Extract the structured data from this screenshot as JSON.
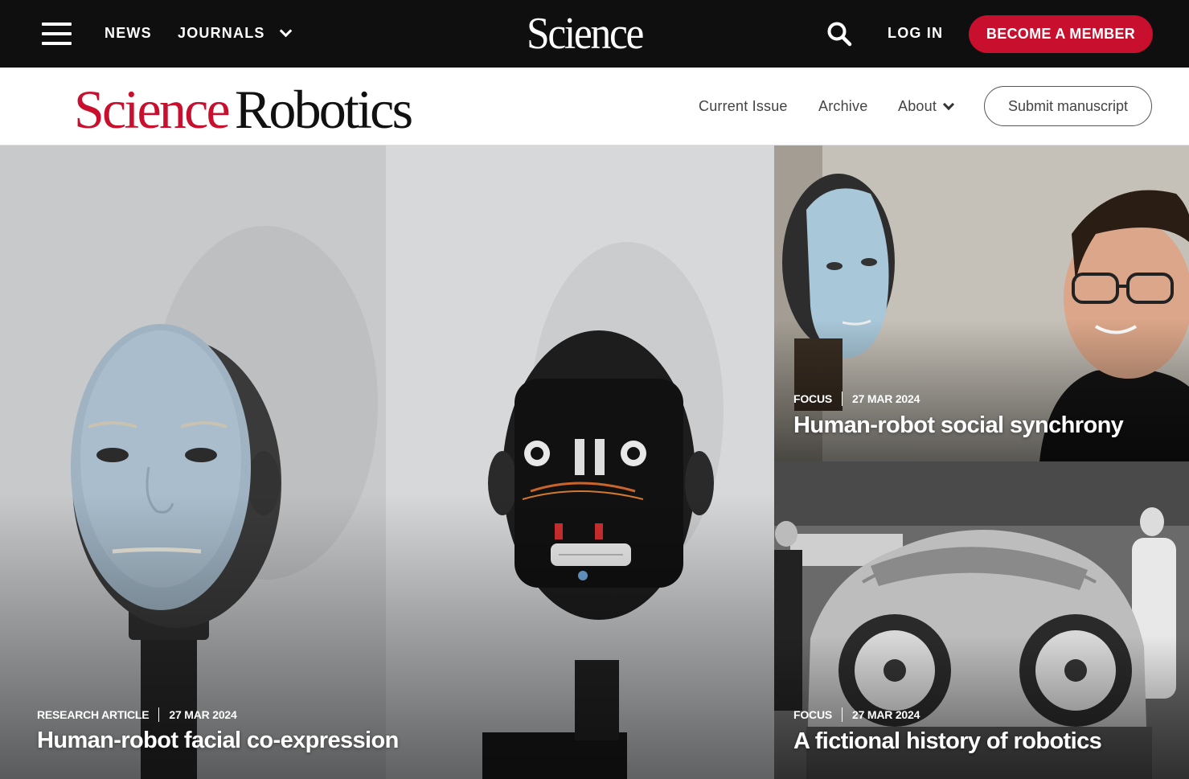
{
  "topbar": {
    "menu_icon": "hamburger-menu-icon",
    "news_label": "NEWS",
    "journals_label": "JOURNALS",
    "logo_text": "Science",
    "search_icon": "search-icon",
    "login_label": "LOG IN",
    "member_label": "BECOME A MEMBER",
    "member_color": "#c8102e"
  },
  "subheader": {
    "brand_science": "Science",
    "brand_robotics": "Robotics",
    "nav": {
      "current_issue": "Current Issue",
      "archive": "Archive",
      "about": "About"
    },
    "submit_label": "Submit manuscript"
  },
  "cards": [
    {
      "type": "RESEARCH ARTICLE",
      "date": "27 MAR 2024",
      "title": "Human-robot facial co-expression"
    },
    {
      "type": "FOCUS",
      "date": "27 MAR 2024",
      "title": "Human-robot social synchrony"
    },
    {
      "type": "FOCUS",
      "date": "27 MAR 2024",
      "title": "A fictional history of robotics"
    }
  ]
}
